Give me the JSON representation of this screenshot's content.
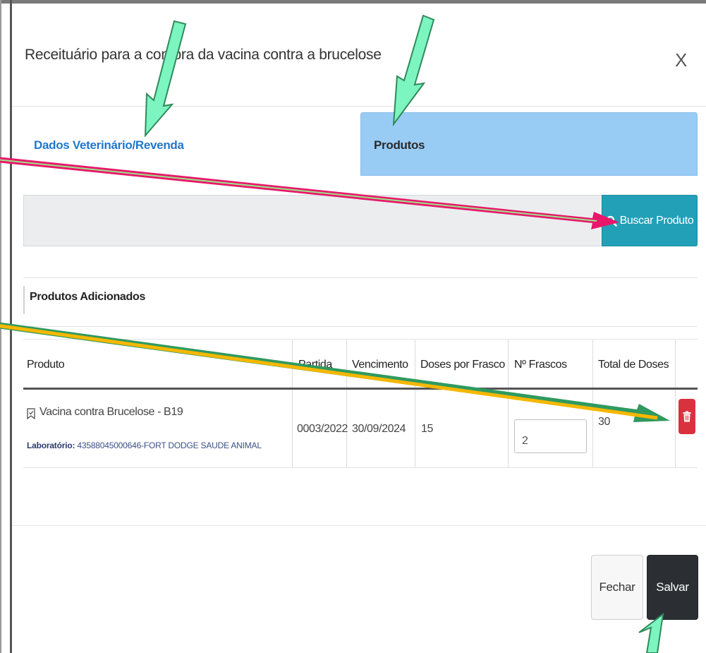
{
  "modal": {
    "title": "Receituário para a compra da vacina contra a brucelose",
    "close": "X"
  },
  "tabs": [
    {
      "label": "Dados Veterinário/Revenda",
      "active": false
    },
    {
      "label": "Produtos",
      "active": true
    }
  ],
  "search": {
    "button_label": "Buscar Produto",
    "icon": "search-icon"
  },
  "section": {
    "title": "Produtos Adicionados"
  },
  "table": {
    "headers": [
      "Produto",
      "Partida",
      "Vencimento",
      "Doses por Frasco",
      "Nº Frascos",
      "Total de Doses"
    ],
    "rows": [
      {
        "produto": "Vacina contra Brucelose - B19",
        "laboratorio_label": "Laboratório:",
        "laboratorio_value": "43588045000646-FORT DODGE SAUDE ANIMAL",
        "partida": "0003/2022",
        "vencimento": "30/09/2024",
        "doses_por_frasco": "15",
        "n_frascos": "2",
        "total_doses": "30"
      }
    ]
  },
  "footer": {
    "close_label": "Fechar",
    "save_label": "Salvar"
  },
  "colors": {
    "active_tab": "#99ccf5",
    "search_button": "#22a0b8",
    "delete_button": "#d9323f",
    "save_button": "#2b2f33",
    "annotation_arrow_green": "#7cf5c0",
    "annotation_arrow_pink": "#e8176a",
    "annotation_arrow_orange": "#f5b700"
  }
}
